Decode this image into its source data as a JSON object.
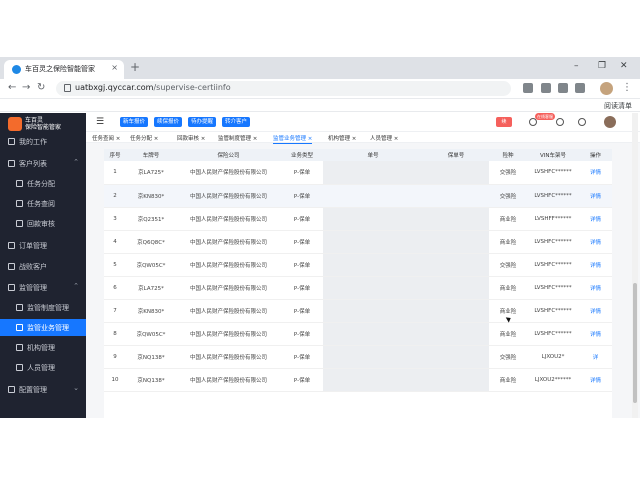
{
  "browser": {
    "tab_title": "车百灵之保险智能管家",
    "tab_close": "×",
    "new_tab": "+",
    "url_host": "uatbxgj.qyccar.com",
    "url_path": "/supervise-certiinfo",
    "reading_list": "阅读清单",
    "win_min": "–",
    "win_max": "❐",
    "win_close": "✕"
  },
  "sidebar": {
    "logo_line1": "车百灵",
    "logo_line2": "保险智能管家",
    "items": [
      {
        "label": "我的工作",
        "icon": "home-icon"
      },
      {
        "label": "客户列表",
        "icon": "user-list-icon",
        "chevron": "⌃"
      },
      {
        "label": "任务分配",
        "icon": "task-icon"
      },
      {
        "label": "任务查阅",
        "icon": "search-doc-icon"
      },
      {
        "label": "回款审核",
        "icon": "audit-icon"
      },
      {
        "label": "订单管理",
        "icon": "order-icon"
      },
      {
        "label": "战败客户",
        "icon": "lost-icon"
      },
      {
        "label": "监管管理",
        "icon": "shield-icon",
        "chevron": "⌃"
      },
      {
        "label": "监管制度管理",
        "icon": "rule-icon"
      },
      {
        "label": "监管业务管理",
        "icon": "business-icon"
      },
      {
        "label": "机构管理",
        "icon": "org-icon"
      },
      {
        "label": "人员管理",
        "icon": "people-icon"
      },
      {
        "label": "配置管理",
        "icon": "config-icon",
        "chevron": "⌄"
      }
    ]
  },
  "topbar": {
    "fold_icon": "☰",
    "quick_buttons": [
      "新车报价",
      "续保报价",
      "待办提醒",
      "转介客户"
    ],
    "red_button": "续",
    "badge": "在线客服"
  },
  "tags": [
    "任务查阅",
    "任务分配",
    "回款审核",
    "监管制度管理",
    "监管业务管理",
    "机构管理",
    "人员管理"
  ],
  "tag_close": "×",
  "table": {
    "headers": [
      "序号",
      "车牌号",
      "保险公司",
      "业务类型",
      "单号",
      "保单号",
      "险种",
      "VIN车架号",
      "操作"
    ],
    "rows": [
      {
        "no": "1",
        "plate": "京LA725*",
        "company": "中国人民财产保险股份有限公司",
        "type": "P-保单",
        "kind": "交强险",
        "vin": "LVSHFC******",
        "op": "详情"
      },
      {
        "no": "2",
        "plate": "京KN830*",
        "company": "中国人民财产保险股份有限公司",
        "type": "P-保单",
        "kind": "交强险",
        "vin": "LVSHFC******",
        "op": "详情"
      },
      {
        "no": "3",
        "plate": "京Q2351*",
        "company": "中国人民财产保险股份有限公司",
        "type": "P-保单",
        "kind": "商业险",
        "vin": "LVSHFF******",
        "op": "详情"
      },
      {
        "no": "4",
        "plate": "京Q6Q8C*",
        "company": "中国人民财产保险股份有限公司",
        "type": "P-保单",
        "kind": "商业险",
        "vin": "LVSHFC******",
        "op": "详情"
      },
      {
        "no": "5",
        "plate": "京QW05C*",
        "company": "中国人民财产保险股份有限公司",
        "type": "P-保单",
        "kind": "交强险",
        "vin": "LVSHFC******",
        "op": "详情"
      },
      {
        "no": "6",
        "plate": "京LA725*",
        "company": "中国人民财产保险股份有限公司",
        "type": "P-保单",
        "kind": "商业险",
        "vin": "LVSHFC******",
        "op": "详情"
      },
      {
        "no": "7",
        "plate": "京KN830*",
        "company": "中国人民财产保险股份有限公司",
        "type": "P-保单",
        "kind": "商业险",
        "vin": "LVSHFC******",
        "op": "详情"
      },
      {
        "no": "8",
        "plate": "京QW05C*",
        "company": "中国人民财产保险股份有限公司",
        "type": "P-保单",
        "kind": "商业险",
        "vin": "LVSHFC******",
        "op": "详情"
      },
      {
        "no": "9",
        "plate": "京NQ138*",
        "company": "中国人民财产保险股份有限公司",
        "type": "P-保单",
        "kind": "交强险",
        "vin": "LJXOU2*",
        "op": "详"
      },
      {
        "no": "10",
        "plate": "京NQ138*",
        "company": "中国人民财产保险股份有限公司",
        "type": "P-保单",
        "kind": "商业险",
        "vin": "LJXOU2******",
        "op": "详情"
      }
    ]
  }
}
